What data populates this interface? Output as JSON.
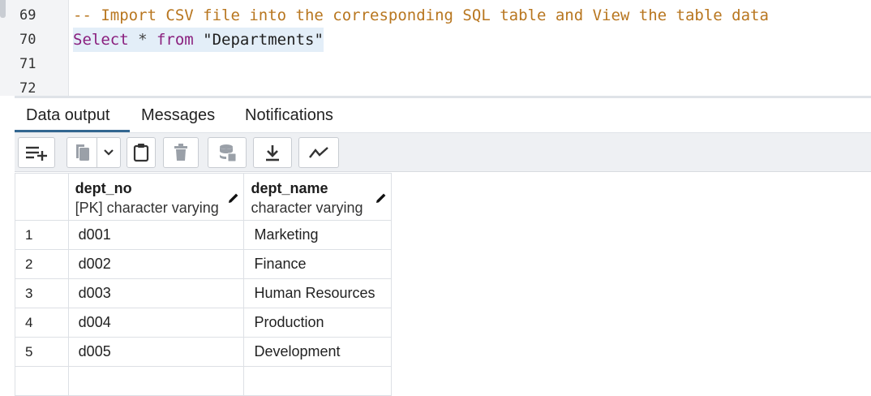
{
  "editor": {
    "lines": [
      {
        "num": "69",
        "comment": "-- Import CSV file into the corresponding SQL table and View the table data"
      },
      {
        "num": "70",
        "kw1": "Select",
        "op": " * ",
        "kw2": "from",
        "str": " \"Departments\""
      },
      {
        "num": "71"
      },
      {
        "num": "72"
      }
    ]
  },
  "tabs": {
    "data_output": "Data output",
    "messages": "Messages",
    "notifications": "Notifications"
  },
  "toolbar": {
    "icons": [
      "add-row-icon",
      "copy-icon",
      "chevron-down-icon",
      "paste-icon",
      "delete-icon",
      "save-data-icon",
      "download-icon",
      "graph-visualiser-icon"
    ]
  },
  "grid": {
    "columns": [
      {
        "name": "dept_no",
        "type": "[PK] character varying"
      },
      {
        "name": "dept_name",
        "type": "character varying"
      }
    ],
    "rows": [
      {
        "num": "1",
        "dept_no": "d001",
        "dept_name": "Marketing"
      },
      {
        "num": "2",
        "dept_no": "d002",
        "dept_name": "Finance"
      },
      {
        "num": "3",
        "dept_no": "d003",
        "dept_name": "Human Resources"
      },
      {
        "num": "4",
        "dept_no": "d004",
        "dept_name": "Production"
      },
      {
        "num": "5",
        "dept_no": "d005",
        "dept_name": "Development"
      }
    ]
  },
  "colors": {
    "accent": "#326690",
    "keyword": "#8a1f7e",
    "comment": "#b8761f"
  }
}
